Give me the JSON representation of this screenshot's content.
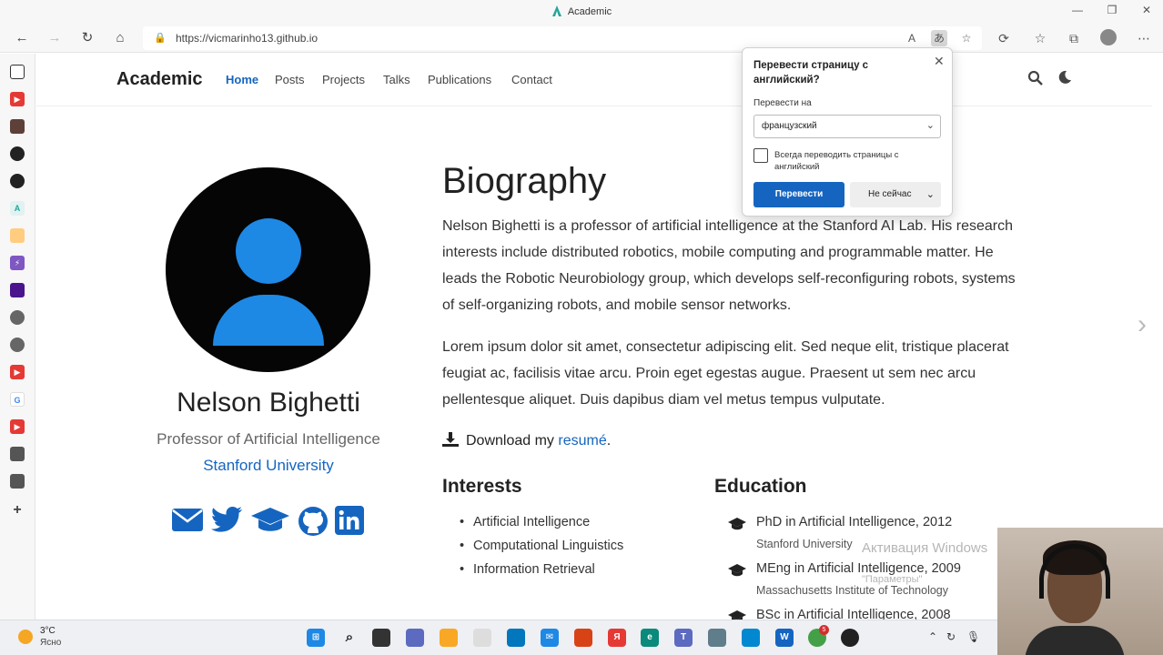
{
  "window": {
    "title": "Academic"
  },
  "browser": {
    "url": "https://vicmarinho13.github.io"
  },
  "site": {
    "brand": "Academic",
    "nav": [
      "Home",
      "Posts",
      "Projects",
      "Talks",
      "Publications",
      "Contact"
    ],
    "active_nav": "Home"
  },
  "profile": {
    "name": "Nelson Bighetti",
    "role": "Professor of Artificial Intelligence",
    "organization": "Stanford University"
  },
  "biography": {
    "title": "Biography",
    "paragraph_1_lines": [
      "Nelson Bighetti is a professor of artificial intelligence at the Stanford AI Lab. His research",
      "interests include distributed robotics, mobile computing and programmable matter. He",
      "leads the Robotic Neurobiology group, which develops self-reconfiguring robots, systems",
      "of self-organizing robots, and mobile sensor networks."
    ],
    "paragraph_2_lines": [
      "Lorem ipsum dolor sit amet, consectetur adipiscing elit. Sed neque elit, tristique placerat",
      "feugiat ac, facilisis vitae arcu. Proin eget egestas augue. Praesent ut sem nec arcu",
      "pellentesque aliquet. Duis dapibus diam vel metus tempus vulputate."
    ],
    "download_prefix": "Download my ",
    "download_link": "resumé",
    "download_suffix": "."
  },
  "interests": {
    "title": "Interests",
    "items": [
      "Artificial Intelligence",
      "Computational Linguistics",
      "Information Retrieval"
    ]
  },
  "education": {
    "title": "Education",
    "items": [
      {
        "course": "PhD in Artificial Intelligence, 2012",
        "institution": "Stanford University"
      },
      {
        "course": "MEng in Artificial Intelligence, 2009",
        "institution": "Massachusetts Institute of Technology"
      },
      {
        "course": "BSc in Artificial Intelligence, 2008",
        "institution": ""
      }
    ]
  },
  "translate_popup": {
    "title": "Перевести страницу с английский?",
    "translate_to_label": "Перевести на",
    "selected_language": "французский",
    "always_translate_label": "Всегда переводить страницы с английский",
    "translate_button": "Перевести",
    "not_now_button": "Не сейчас"
  },
  "watermark": {
    "line1": "Активация Windows",
    "line2": "\"Параметры\""
  },
  "taskbar": {
    "weather_temp": "3°C",
    "weather_desc": "Ясно",
    "badge_count": "5"
  },
  "colors": {
    "accent": "#1565c0",
    "avatar_blue": "#1e88e5"
  }
}
